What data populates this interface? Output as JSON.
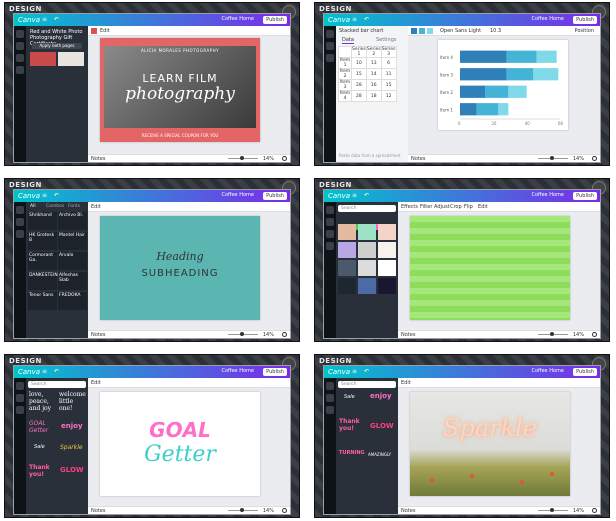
{
  "app": {
    "desk_logo": "DESIGN",
    "logo": "Canva",
    "share_label": "Coffee Home",
    "publish_label": "Publish",
    "help_label": "?"
  },
  "tiles": [
    {
      "panel_title": "Red and White Photo Photography Gift Certificate",
      "panel_button": "Apply both pages",
      "page_label": "Edit",
      "design": {
        "kicker": "ALICIA MORALES PHOTOGRAPHY",
        "title_line1": "LEARN FILM",
        "title_line2": "photography",
        "footer": "RECEIVE A SPECIAL COUPON FOR YOU"
      },
      "notes_label": "Notes",
      "zoom": "14%"
    },
    {
      "toolbar": {
        "chart_type": "Stacked bar chart",
        "font": "Open Sans Light",
        "font_size": "10.3",
        "position": "Position"
      },
      "tabs": [
        "Data",
        "Settings"
      ],
      "table": {
        "headers": [
          "",
          "Series 1",
          "Series 2",
          "Series 3"
        ],
        "rows": [
          [
            "Item 1",
            "10",
            "13",
            "6"
          ],
          [
            "Item 2",
            "15",
            "14",
            "11"
          ],
          [
            "Item 3",
            "28",
            "16",
            "15"
          ],
          [
            "Item 4",
            "28",
            "18",
            "12"
          ]
        ]
      },
      "chart_data": {
        "type": "bar",
        "orientation": "horizontal",
        "stacked": true,
        "categories": [
          "Item 4",
          "Item 3",
          "Item 2",
          "Item 1"
        ],
        "series": [
          {
            "name": "Series 1",
            "values": [
              28,
              28,
              15,
              10
            ],
            "color": "#2f7fb8"
          },
          {
            "name": "Series 2",
            "values": [
              18,
              16,
              14,
              13
            ],
            "color": "#44b3d6"
          },
          {
            "name": "Series 3",
            "values": [
              12,
              15,
              11,
              6
            ],
            "color": "#7fd9e8"
          }
        ],
        "xlim": [
          0,
          60
        ]
      },
      "chart_hint": "Paste data from a spreadsheet",
      "notes_label": "Notes",
      "zoom": "14%"
    },
    {
      "tabs": [
        "All",
        "Combos",
        "Fonts"
      ],
      "fonts": [
        "Shrikhand",
        "Archivo Bl.",
        "HK Grotesk B",
        "Mantel Hair",
        "Cormorant Ga.",
        "Arvalo",
        "DANKESTEIN",
        "Alfeshas Slab",
        "Tenor Sans",
        "FREDOKA"
      ],
      "page_label": "Edit",
      "design": {
        "heading": "Heading",
        "subheading": "SUBHEADING",
        "bg": "#5bb6b2"
      },
      "notes_label": "Notes",
      "zoom": "14%"
    },
    {
      "search_placeholder": "Search",
      "toolbar": [
        "Effects",
        "Filter",
        "Adjust",
        "Crop",
        "Flip",
        "Edit"
      ],
      "notes_label": "Notes",
      "zoom": "14%"
    },
    {
      "search_placeholder": "Search",
      "stickers": [
        "love, peace, and joy",
        "welcome little one!",
        "GOAL Getter",
        "enjoy",
        "Sale",
        "Sparkle",
        "Thank you!",
        "GLOW"
      ],
      "page_label": "Edit",
      "design": {
        "line1": "GOAL",
        "line2": "Getter"
      },
      "notes_label": "Notes",
      "zoom": "14%"
    },
    {
      "search_placeholder": "Search",
      "stickers": [
        "Sale",
        "enjoy",
        "Thank you!",
        "GLOW",
        "TURNING",
        "AMAZINGLY"
      ],
      "page_label": "Edit",
      "design": {
        "word": "Sparkle"
      },
      "notes_label": "Notes",
      "zoom": "14%"
    }
  ]
}
